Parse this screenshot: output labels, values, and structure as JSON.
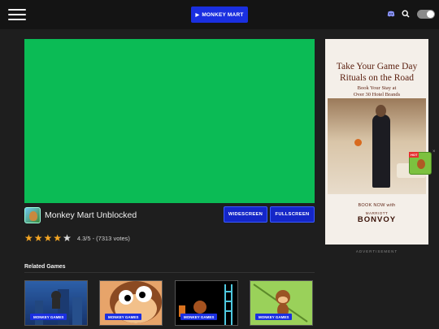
{
  "header": {
    "menu_icon": "hamburger-icon",
    "cta_label": "MONKEY MART",
    "cta_icon": "play-icon",
    "icons": [
      "discord-icon",
      "search-icon"
    ],
    "theme_toggle": "dark"
  },
  "game": {
    "title": "Monkey Mart Unblocked",
    "frame_color": "#0bbb55",
    "buttons": {
      "widescreen": "WIDESCREEN",
      "fullscreen": "FULLSCREEN"
    },
    "rating": {
      "stars": 4.3,
      "text": "4.3/5 - (7313 votes)"
    }
  },
  "related": {
    "title": "Related Games",
    "cards": [
      {
        "badge": "MONKEY GAMES",
        "color": "#2c5fa8"
      },
      {
        "badge": "MONKEY GAMES",
        "color": "#e7a46a"
      },
      {
        "badge": "MONKEY GAMES",
        "color": "#000000"
      },
      {
        "badge": "MONKEY GAMES",
        "color": "#9ad15a"
      }
    ]
  },
  "ad": {
    "headline_1": "Take Your Game Day",
    "headline_2": "Rituals on the Road",
    "sub_1": "Book Your Stay at",
    "sub_2": "Over 30 Hotel Brands",
    "book": "BOOK NOW with",
    "brand_small": "MARRIOTT",
    "brand": "BONVOY",
    "label": "ADVERTISEMENT",
    "mini_badge": "HOT",
    "close": "×"
  },
  "colors": {
    "accent": "#1a2fe0",
    "background": "#1e1e1e",
    "star": "#f5a623"
  }
}
